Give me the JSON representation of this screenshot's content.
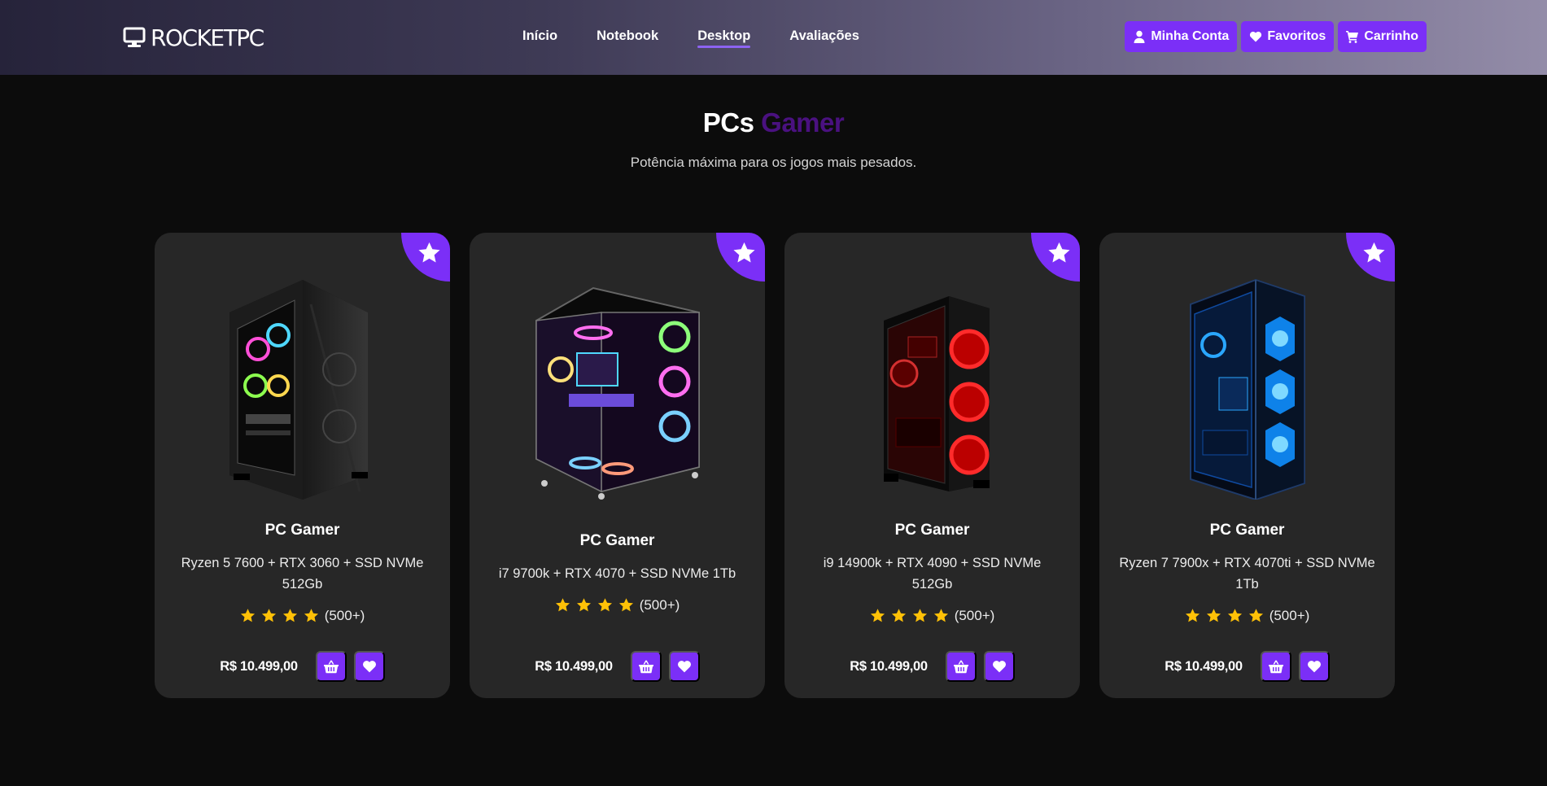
{
  "header": {
    "logo": {
      "text": "ROCKETPC",
      "icon": "desktop-icon"
    },
    "nav": [
      {
        "label": "Início",
        "active": false
      },
      {
        "label": "Notebook",
        "active": false
      },
      {
        "label": "Desktop",
        "active": true
      },
      {
        "label": "Avaliações",
        "active": false
      }
    ],
    "buttons": {
      "account": {
        "label": "Minha Conta",
        "icon": "user-icon"
      },
      "favorites": {
        "label": "Favoritos",
        "icon": "heart-icon"
      },
      "cart": {
        "label": "Carrinho",
        "icon": "cart-icon"
      }
    }
  },
  "section": {
    "title_main": "PCs",
    "title_accent": "Gamer",
    "subtitle": "Potência máxima para os jogos mais pesados."
  },
  "products": [
    {
      "title": "PC Gamer",
      "description": "Ryzen 5 7600 + RTX 3060 + SSD NVMe 512Gb",
      "stars": 4,
      "reviews": "(500+)",
      "price": "R$ 10.499,00",
      "image": "pc-case-rgb-rainbow"
    },
    {
      "title": "PC Gamer",
      "description": "i7 9700k + RTX 4070 + SSD NVMe 1Tb",
      "stars": 4,
      "reviews": "(500+)",
      "price": "R$ 10.499,00",
      "image": "pc-case-rgb-aquarium"
    },
    {
      "title": "PC Gamer",
      "description": "i9 14900k + RTX 4090 + SSD NVMe 512Gb",
      "stars": 4,
      "reviews": "(500+)",
      "price": "R$ 10.499,00",
      "image": "pc-case-red-fans"
    },
    {
      "title": "PC Gamer",
      "description": "Ryzen 7 7900x + RTX 4070ti + SSD NVMe 1Tb",
      "stars": 4,
      "reviews": "(500+)",
      "price": "R$ 10.499,00",
      "image": "pc-case-blue-fans"
    }
  ],
  "colors": {
    "accent": "#7b2ff7",
    "title_accent": "#4a1180",
    "card_bg": "#272727",
    "page_bg": "#0c0c0c",
    "star": "#ffc107"
  }
}
